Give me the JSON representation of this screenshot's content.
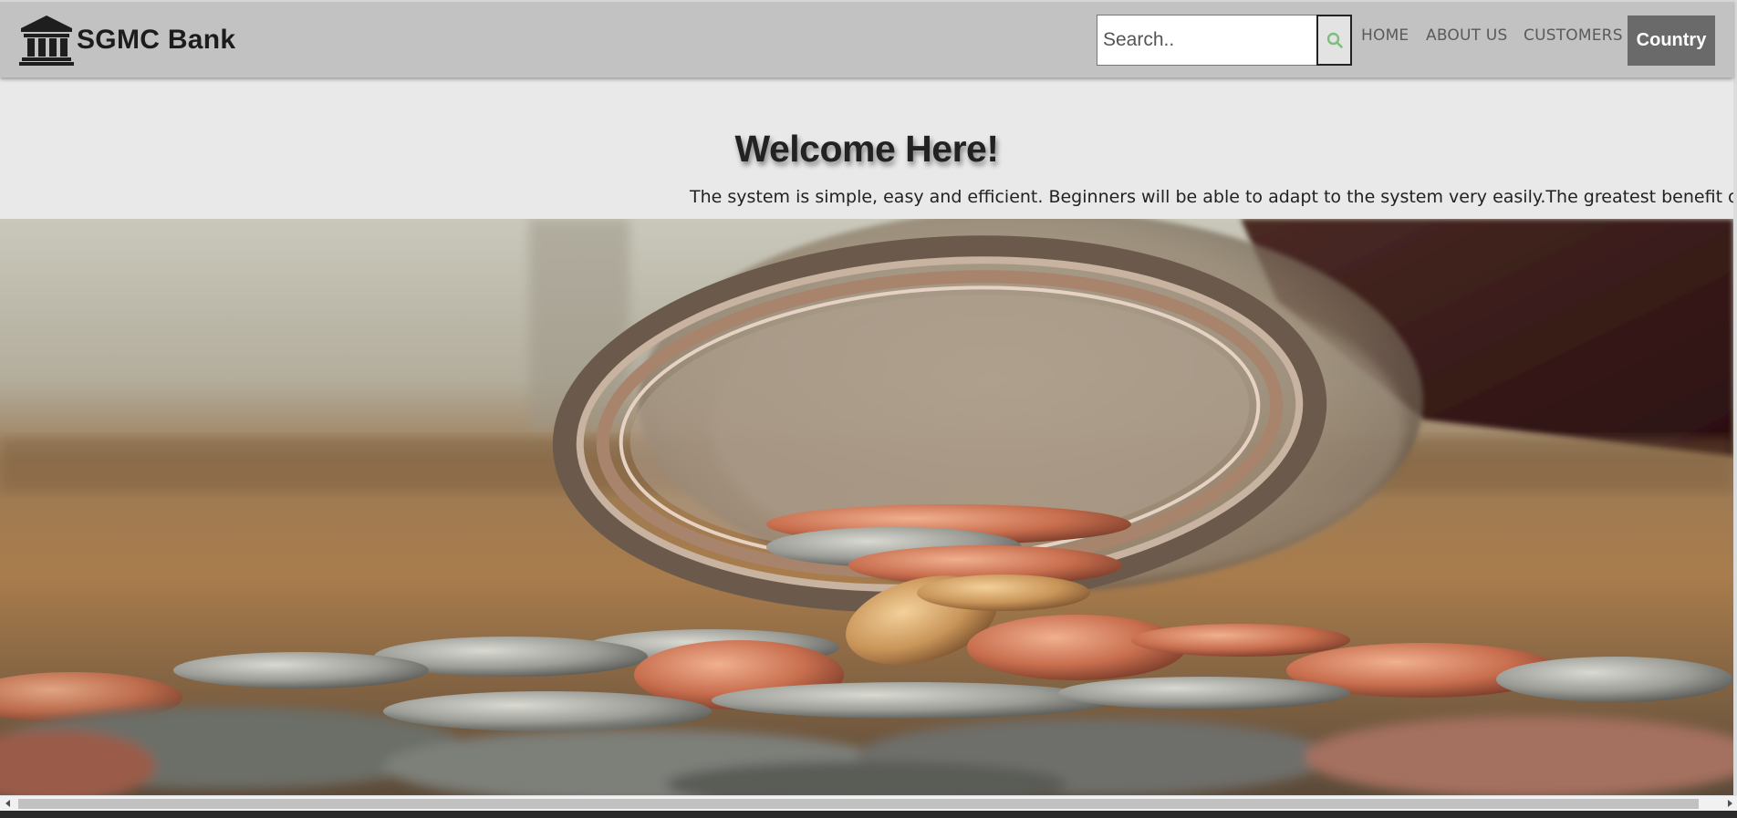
{
  "brand": {
    "name": "SGMC Bank",
    "icon": "bank-building-icon"
  },
  "search": {
    "placeholder": "Search..",
    "value": "",
    "button_icon": "search-icon"
  },
  "nav": {
    "links": [
      {
        "label": "HOME"
      },
      {
        "label": "ABOUT US"
      },
      {
        "label": "CUSTOMERS"
      }
    ],
    "country_label": "Country"
  },
  "welcome": {
    "title": "Welcome Here!",
    "marquee": "The system is simple, easy and efficient. Beginners will be able to adapt to the system very easily.The greatest benefit of the service"
  },
  "hero": {
    "image_description_icon": "coins-spilling-from-jar-photo"
  },
  "scrollbar": {
    "left_icon": "scroll-left-arrow-icon",
    "right_icon": "scroll-right-arrow-icon"
  },
  "colors": {
    "navbar_bg": "#c2c2c2",
    "page_bg": "#e8e9e8",
    "country_button_bg": "#6a6a6a",
    "search_icon": "#7cbf7c"
  }
}
